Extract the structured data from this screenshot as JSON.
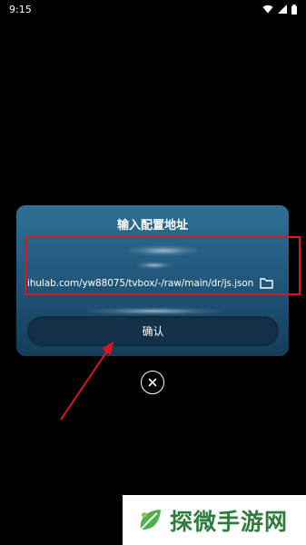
{
  "status_bar": {
    "time": "9:15"
  },
  "dialog": {
    "title": "输入配置地址",
    "url_value": "ihulab.com/yw88075/tvbox/-/raw/main/dr/js.json",
    "confirm_label": "确认"
  },
  "watermark": {
    "text": "探微手游网"
  },
  "colors": {
    "dialog_top": "#2f6f95",
    "dialog_bottom": "#123d5a",
    "button": "#13324a",
    "highlight": "#e0141e",
    "watermark_green": "#2c7c3c"
  },
  "icons": {
    "folder": "folder-icon",
    "close": "close-icon",
    "wifi": "wifi-icon",
    "signal": "signal-icon",
    "battery": "battery-icon"
  }
}
